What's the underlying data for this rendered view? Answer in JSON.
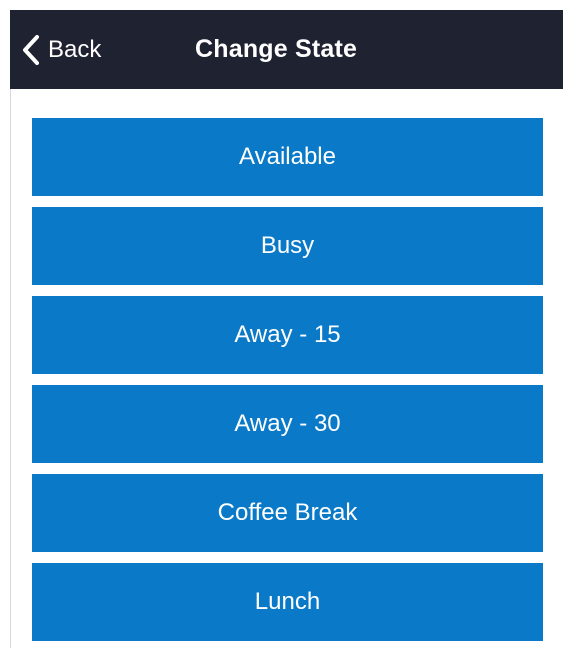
{
  "header": {
    "back_label": "Back",
    "title": "Change State"
  },
  "states": [
    {
      "label": "Available"
    },
    {
      "label": "Busy"
    },
    {
      "label": "Away - 15"
    },
    {
      "label": "Away - 30"
    },
    {
      "label": "Coffee Break"
    },
    {
      "label": "Lunch"
    }
  ],
  "colors": {
    "topbar_bg": "#1f2230",
    "button_bg": "#0a7ac8",
    "text_on_dark": "#ffffff"
  },
  "icons": {
    "back": "chevron-left-icon"
  }
}
